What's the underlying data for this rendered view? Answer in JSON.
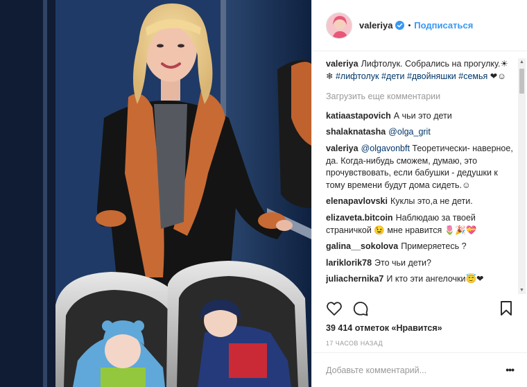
{
  "post": {
    "username": "valeriya",
    "follow_label": "Подписаться",
    "caption": {
      "user": "valeriya",
      "text": "Лифтолук. Собрались на прогулку.☀❄ ",
      "tags": [
        "#лифтолук",
        "#дети",
        "#двойняшки",
        "#семья"
      ],
      "tail": " ❤☺"
    },
    "load_more": "Загрузить еще комментарии",
    "comments": [
      {
        "user": "katiaastapovich",
        "text": "А чьи это дети",
        "mention": ""
      },
      {
        "user": "shalaknatasha",
        "text": "",
        "mention": "@olga_grit"
      },
      {
        "user": "valeriya",
        "mention": "@olgavonbft",
        "text": " Теоретически- наверное, да. Когда-нибудь сможем, думаю, это прочувствовать, если бабушки - дедушки к тому времени будут дома сидеть.☺"
      },
      {
        "user": "elenapavlovski",
        "text": "Куклы это,а не дети.",
        "mention": ""
      },
      {
        "user": "elizaveta.bitcoin",
        "text": "Наблюдаю за твоей страничкой 😉 мне нравится 🌷🎉💝",
        "mention": ""
      },
      {
        "user": "galina__sokolova",
        "text": "Примеряетесь ?",
        "mention": ""
      },
      {
        "user": "lariklorik78",
        "text": "Это чьи дети?",
        "mention": ""
      },
      {
        "user": "juliachernika7",
        "text": "И кто эти ангелочки😇❤",
        "mention": ""
      }
    ],
    "likes": "39 414 отметок «Нравится»",
    "timestamp": "17 ЧАСОВ НАЗАД",
    "add_comment_placeholder": "Добавьте комментарий...",
    "options_label": "•••",
    "icons": [
      "heart-icon",
      "comment-icon",
      "bookmark-icon",
      "verified-icon"
    ],
    "colors": {
      "link": "#3897f0",
      "hashtag": "#003569",
      "muted": "#999999",
      "verified": "#3897f0"
    }
  }
}
